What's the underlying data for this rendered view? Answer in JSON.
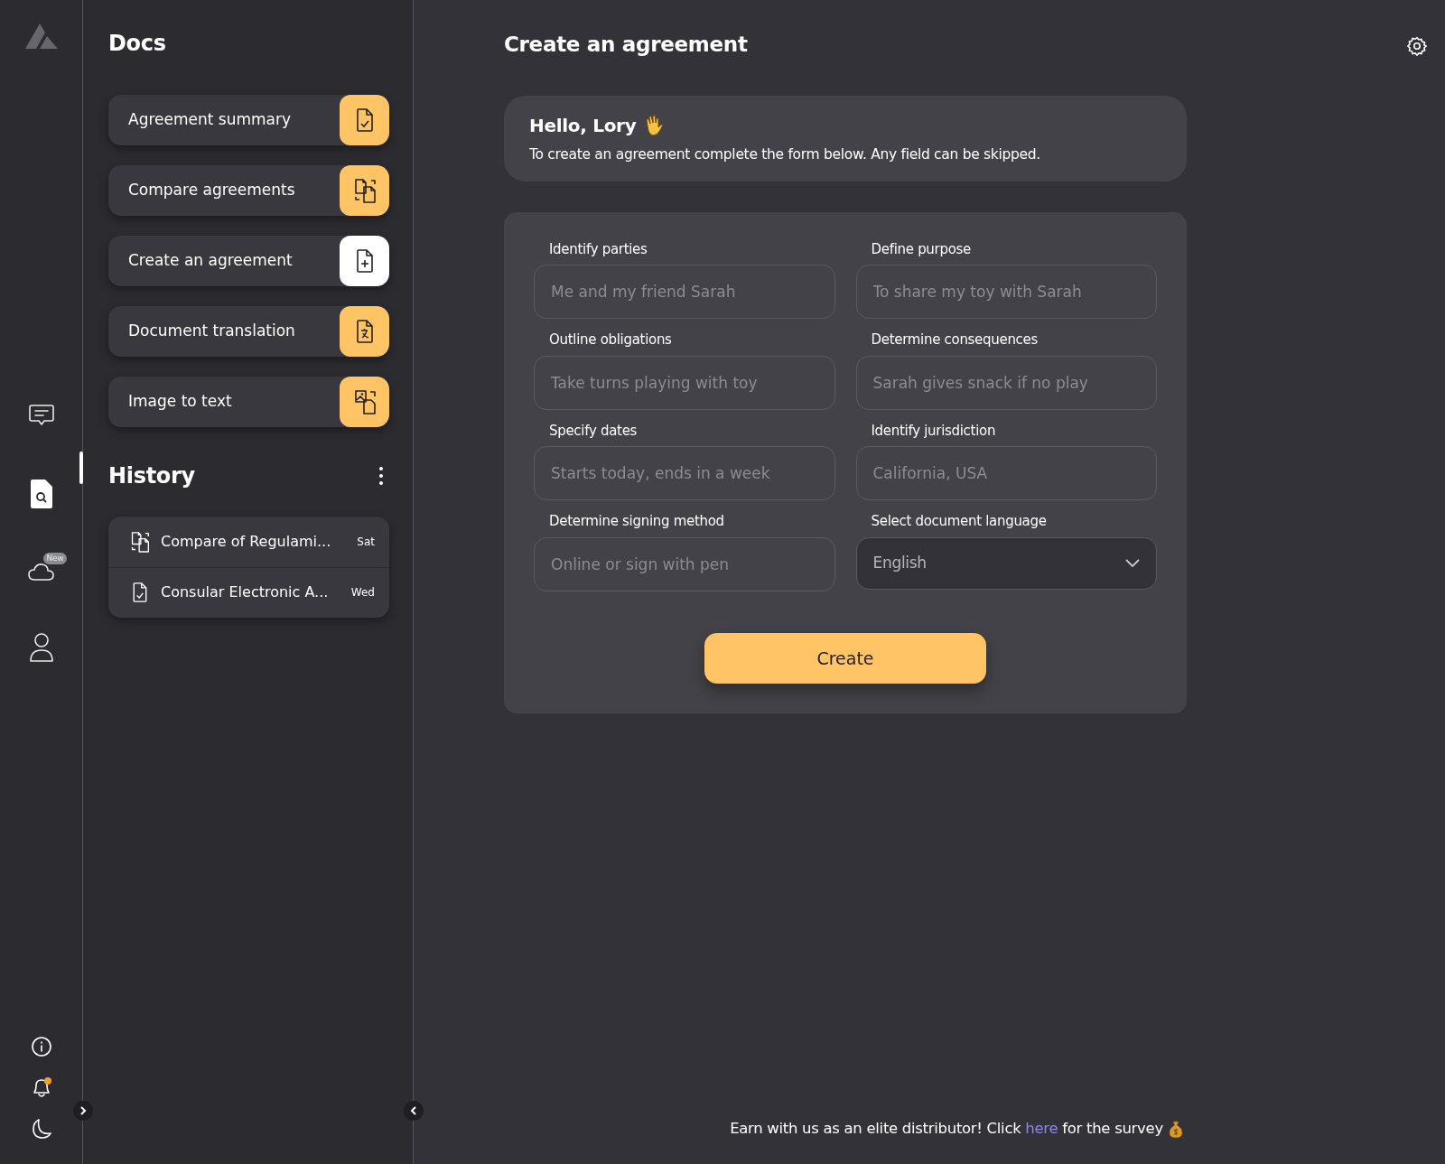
{
  "rail": {
    "top": [
      {
        "kind": "chat",
        "selected": false
      },
      {
        "kind": "doc-search",
        "selected": true
      },
      {
        "kind": "cloud",
        "selected": false,
        "badge": "New"
      },
      {
        "kind": "user",
        "selected": false
      }
    ],
    "bottom": [
      {
        "kind": "info"
      },
      {
        "kind": "bell",
        "alert": true
      },
      {
        "kind": "moon"
      }
    ]
  },
  "sidebar": {
    "title": "Docs",
    "tools": [
      {
        "label": "Agreement summary",
        "kind": "check",
        "selected": false
      },
      {
        "label": "Compare agreements",
        "kind": "compare",
        "selected": false
      },
      {
        "label": "Create an agreement",
        "kind": "plus",
        "selected": true
      },
      {
        "label": "Document translation",
        "kind": "translate",
        "selected": false
      },
      {
        "label": "Image to text",
        "kind": "image",
        "selected": false
      }
    ],
    "history_title": "History",
    "history": [
      {
        "title": "Compare of Regulami...",
        "day": "Sat",
        "kind": "compare"
      },
      {
        "title": "Consular Electronic A...",
        "day": "Wed",
        "kind": "check"
      }
    ]
  },
  "main": {
    "title": "Create an agreement",
    "greeting": {
      "title": "Hello, Lory",
      "text": "To create an agreement complete the form below. Any field can be skipped."
    },
    "fields": [
      {
        "label": "Identify parties",
        "kind": "input",
        "placeholder": "Me and my friend Sarah"
      },
      {
        "label": "Define purpose",
        "kind": "input",
        "placeholder": "To share my toy with Sarah"
      },
      {
        "label": "Outline obligations",
        "kind": "input",
        "placeholder": "Take turns playing with toy"
      },
      {
        "label": "Determine consequences",
        "kind": "input",
        "placeholder": "Sarah gives snack if no play"
      },
      {
        "label": "Specify dates",
        "kind": "input",
        "placeholder": "Starts today, ends in a week"
      },
      {
        "label": "Identify jurisdiction",
        "kind": "input",
        "placeholder": "California, USA"
      },
      {
        "label": "Determine signing method",
        "kind": "input",
        "placeholder": "Online or sign with pen"
      },
      {
        "label": "Select document language",
        "kind": "select",
        "value": "English"
      }
    ],
    "submit": "Create"
  },
  "footer": {
    "before": "Earn with us as an elite distributor! Click",
    "link": "here",
    "after": "for the survey"
  }
}
